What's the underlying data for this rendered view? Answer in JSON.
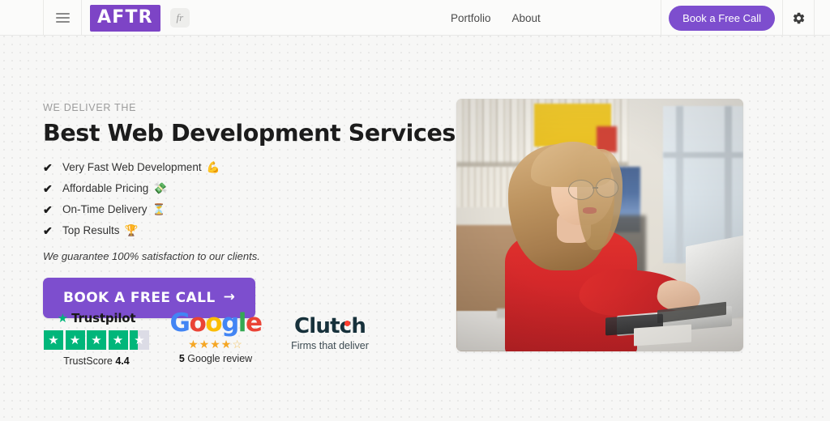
{
  "header": {
    "menu_icon": "hamburger-menu-icon",
    "logo_text": "AFTR",
    "lang_badge": "fr",
    "nav": [
      {
        "label": "Portfolio"
      },
      {
        "label": "About"
      }
    ],
    "cta_label": "Book a Free Call",
    "settings_icon": "gear-icon",
    "logo_bg_color": "#7d44c6",
    "cta_color": "#7d4ece"
  },
  "hero": {
    "eyebrow": "WE DELIVER THE",
    "headline": "Best Web Development Services",
    "features": [
      {
        "check": "✔",
        "label": "Very Fast Web Development",
        "emoji": "💪"
      },
      {
        "check": "✔",
        "label": "Affordable Pricing",
        "emoji": "💸"
      },
      {
        "check": "✔",
        "label": "On-Time Delivery",
        "emoji": "⏳"
      },
      {
        "check": "✔",
        "label": "Top Results",
        "emoji": "🏆"
      }
    ],
    "guarantee": "We guarantee 100% satisfaction to our clients.",
    "cta_label": "BOOK A FREE CALL",
    "cta_arrow": "→",
    "image_alt": "Woman in red sweater with glasses typing on a laptop in an office"
  },
  "badges": {
    "trustpilot": {
      "name": "Trustpilot",
      "star_glyph": "★",
      "stars_filled": 4,
      "partial_fill_pct": 40,
      "score_label": "TrustScore",
      "score_value": "4.4",
      "brand_color": "#00b67a"
    },
    "google": {
      "letters": [
        "G",
        "o",
        "o",
        "g",
        "l",
        "e"
      ],
      "stars": "★★★★",
      "half_star": "☆",
      "rating": 4.5,
      "count": "5",
      "review_label": "Google review"
    },
    "clutch": {
      "name": "Clutch",
      "tagline": "Firms that deliver",
      "dot_color": "#ff3d2e"
    }
  }
}
